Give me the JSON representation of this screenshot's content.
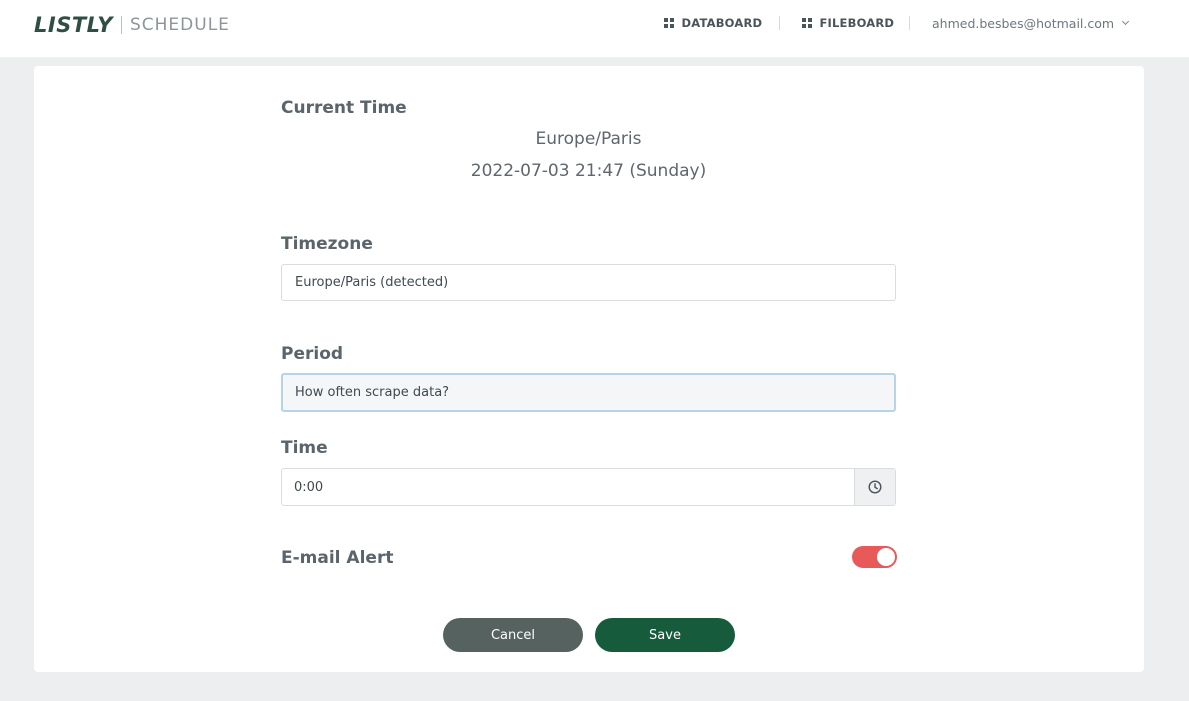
{
  "header": {
    "logo": "LISTLY",
    "section": "SCHEDULE",
    "nav": [
      {
        "label": "DATABOARD",
        "icon": "grid-icon"
      },
      {
        "label": "FILEBOARD",
        "icon": "grid-icon"
      }
    ],
    "user_email": "ahmed.besbes@hotmail.com"
  },
  "current_time": {
    "label": "Current Time",
    "timezone": "Europe/Paris",
    "datetime": "2022-07-03 21:47 (Sunday)"
  },
  "timezone": {
    "label": "Timezone",
    "value": "Europe/Paris (detected)"
  },
  "period": {
    "label": "Period",
    "placeholder": "How often scrape data?"
  },
  "time": {
    "label": "Time",
    "value": "0:00",
    "icon": "clock-icon"
  },
  "email_alert": {
    "label": "E-mail Alert",
    "enabled": true
  },
  "buttons": {
    "cancel": "Cancel",
    "save": "Save"
  },
  "colors": {
    "toggle_on": "#e85a5a",
    "save": "#165c3c",
    "cancel": "#56625f"
  }
}
